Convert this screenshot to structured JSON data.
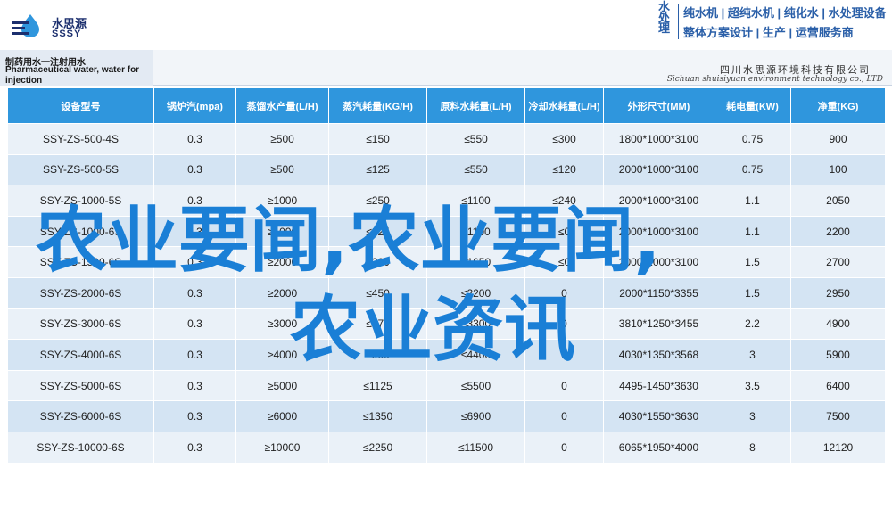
{
  "header": {
    "logo_cn": "水思源",
    "logo_en": "SSSY",
    "logo_icon": "water-drop-icon",
    "tagline_vertical": "水处理",
    "tagline_line1": "纯水机 | 超纯水机 | 纯化水 | 水处理设备",
    "tagline_line2": "整体方案设计 | 生产 | 运营服务商"
  },
  "title": {
    "line1": "制药用水一注射用水",
    "line2": "Pharmaceutical water, water for",
    "line3": "injection",
    "company_cn": "四川水思源环境科技有限公司",
    "company_en": "Sichuan shuisiyuan environment technology co., LTD"
  },
  "table": {
    "headers": [
      "设备型号",
      "锅炉汽(mpa)",
      "蒸馏水产量(L/H)",
      "蒸汽耗量(KG/H)",
      "原料水耗量(L/H)",
      "冷却水耗量(L/H)",
      "外形尺寸(MM)",
      "耗电量(KW)",
      "净重(KG)"
    ],
    "rows": [
      [
        "SSY-ZS-500-4S",
        "0.3",
        "≥500",
        "≤150",
        "≤550",
        "≤300",
        "1800*1000*3100",
        "0.75",
        "900"
      ],
      [
        "SSY-ZS-500-5S",
        "0.3",
        "≥500",
        "≤125",
        "≤550",
        "≤120",
        "2000*1000*3100",
        "0.75",
        "100"
      ],
      [
        "SSY-ZS-1000-5S",
        "0.3",
        "≥1000",
        "≤250",
        "≤1100",
        "≤240",
        "2000*1000*3100",
        "1.1",
        "2050"
      ],
      [
        "SSY-ZS-1000-6S",
        "0.3",
        "≥1000",
        "≤225",
        "≤1100",
        "≤0",
        "2000*1000*3100",
        "1.1",
        "2200"
      ],
      [
        "SSY-ZS-1500-6S",
        "0.3",
        "≥2000",
        "≤300",
        "≤1650",
        "≤0",
        "2000*1000*3100",
        "1.5",
        "2700"
      ],
      [
        "SSY-ZS-2000-6S",
        "0.3",
        "≥2000",
        "≤450",
        "≤2200",
        "0",
        "2000*1150*3355",
        "1.5",
        "2950"
      ],
      [
        "SSY-ZS-3000-6S",
        "0.3",
        "≥3000",
        "≤675",
        "≤3300",
        "0",
        "3810*1250*3455",
        "2.2",
        "4900"
      ],
      [
        "SSY-ZS-4000-6S",
        "0.3",
        "≥4000",
        "≤900",
        "≤4400",
        "0",
        "4030*1350*3568",
        "3",
        "5900"
      ],
      [
        "SSY-ZS-5000-6S",
        "0.3",
        "≥5000",
        "≤1125",
        "≤5500",
        "0",
        "4495-1450*3630",
        "3.5",
        "6400"
      ],
      [
        "SSY-ZS-6000-6S",
        "0.3",
        "≥6000",
        "≤1350",
        "≤6900",
        "0",
        "4030*1550*3630",
        "3",
        "7500"
      ],
      [
        "SSY-ZS-10000-6S",
        "0.3",
        "≥10000",
        "≤2250",
        "≤11500",
        "0",
        "6065*1950*4000",
        "8",
        "12120"
      ]
    ]
  },
  "watermark": {
    "line1": "农业要闻,农业要闻,",
    "line2": "农业资讯"
  },
  "colors": {
    "header_blue": "#2f96dd",
    "row_odd": "#eaf1f8",
    "row_even": "#d4e4f3",
    "watermark": "#1a7fd6",
    "brand_navy": "#1c2f6e"
  }
}
